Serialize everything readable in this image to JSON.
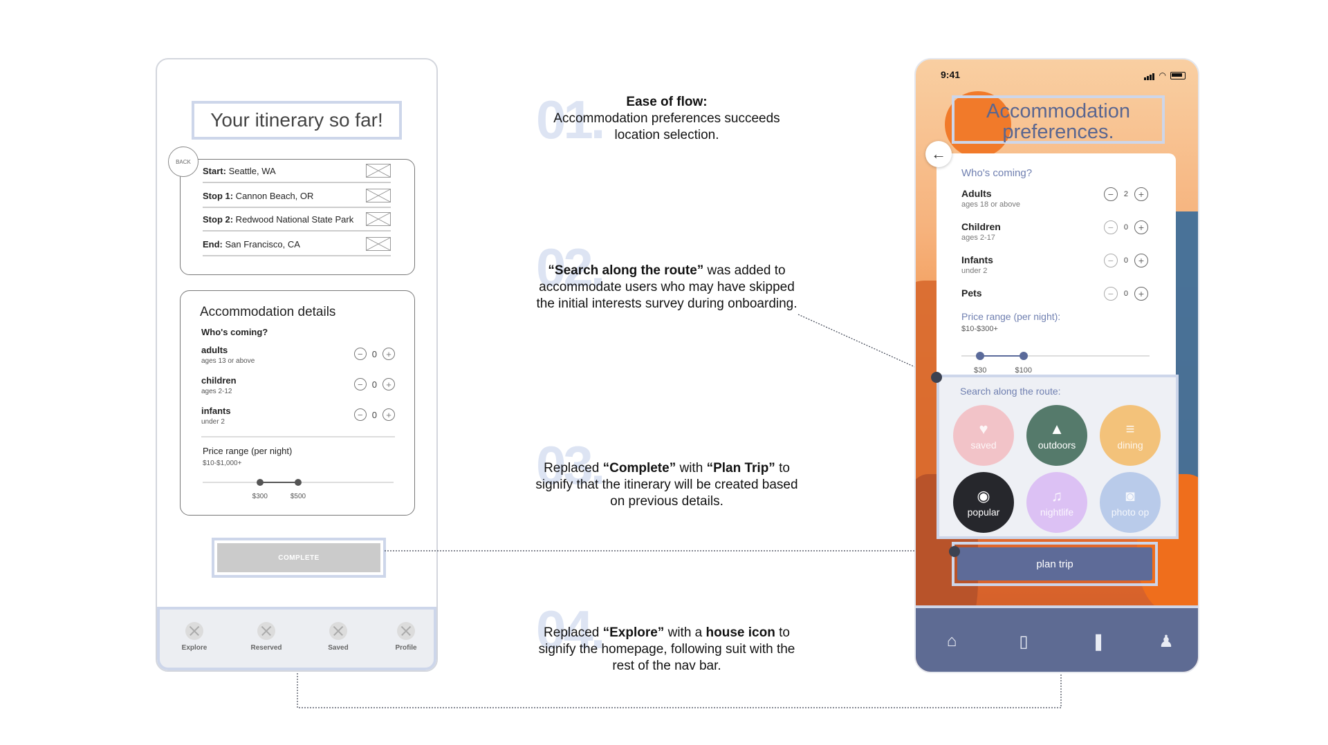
{
  "wireframe": {
    "title": "Your itinerary so far!",
    "back_label": "BACK",
    "stops": [
      {
        "label": "Start:",
        "value": " Seattle, WA"
      },
      {
        "label": "Stop 1:",
        "value": " Cannon Beach, OR"
      },
      {
        "label": "Stop 2:",
        "value": " Redwood National State Park"
      },
      {
        "label": "End:",
        "value": " San Francisco, CA"
      }
    ],
    "accommodation": {
      "heading": "Accommodation details",
      "whos_coming": "Who's coming?",
      "guests": [
        {
          "label": "adults",
          "sub": "ages 13 or above",
          "count": "0"
        },
        {
          "label": "children",
          "sub": "ages 2-12",
          "count": "0"
        },
        {
          "label": "infants",
          "sub": "under 2",
          "count": "0"
        }
      ],
      "price_label": "Price range (per night)",
      "price_range": "$10-$1,000+",
      "slider_low": "$300",
      "slider_high": "$500",
      "slider_low_frac": 0.3,
      "slider_high_frac": 0.5
    },
    "complete_label": "COMPLETE",
    "nav": [
      "Explore",
      "Reserved",
      "Saved",
      "Profile"
    ]
  },
  "annotations": [
    {
      "num": "01.",
      "parts": [
        {
          "b": "Ease of flow:"
        },
        {
          "t": "Accommodation preferences succeeds location selection."
        }
      ]
    },
    {
      "num": "02.",
      "parts": [
        {
          "b": "“Search along the route”"
        },
        {
          "t": " was added to accommodate users who may have skipped the initial interests survey during onboarding."
        }
      ]
    },
    {
      "num": "03.",
      "parts": [
        {
          "t": "Replaced "
        },
        {
          "b": "“Complete”"
        },
        {
          "t": " with "
        },
        {
          "b": "“Plan Trip”"
        },
        {
          "t": " to signify that the itinerary will be created based on previous details."
        }
      ]
    },
    {
      "num": "04.",
      "parts": [
        {
          "t": "Replaced "
        },
        {
          "b": "“Explore”"
        },
        {
          "t": " with a "
        },
        {
          "b": "house icon"
        },
        {
          "t": " to signify the homepage, following suit with the rest of the nav bar."
        }
      ]
    }
  ],
  "hifi": {
    "time": "9:41",
    "title": "Accommodation preferences.",
    "whos_coming": "Who's coming?",
    "guests": [
      {
        "label": "Adults",
        "sub": "ages 18 or above",
        "count": "2",
        "minus_enabled": true
      },
      {
        "label": "Children",
        "sub": "ages 2-17",
        "count": "0",
        "minus_enabled": false
      },
      {
        "label": "Infants",
        "sub": "under 2",
        "count": "0",
        "minus_enabled": false
      },
      {
        "label": "Pets",
        "sub": "",
        "count": "0",
        "minus_enabled": false
      }
    ],
    "price_label": "Price range (per night):",
    "price_range": "$10-$300+",
    "slider_low": "$30",
    "slider_high": "$100",
    "slider_low_frac": 0.1,
    "slider_high_frac": 0.33,
    "route_label": "Search along the route:",
    "categories": [
      {
        "label": "saved",
        "icon": "heart-icon",
        "color": "#f2c3c8",
        "faded": true
      },
      {
        "label": "outdoors",
        "icon": "mountain-icon",
        "color": "#557a6b",
        "faded": false
      },
      {
        "label": "dining",
        "icon": "drink-icon",
        "color": "#f3c27a",
        "faded": true
      },
      {
        "label": "popular",
        "icon": "eye-icon",
        "color": "#26272c",
        "faded": false
      },
      {
        "label": "nightlife",
        "icon": "music-icon",
        "color": "#dcc1f4",
        "faded": true
      },
      {
        "label": "photo op",
        "icon": "camera-icon",
        "color": "#b9cbea",
        "faded": true
      }
    ],
    "plan_label": "plan trip",
    "nav_icons": [
      "home-icon",
      "reserved-icon",
      "bookmark-icon",
      "profile-icon"
    ]
  }
}
